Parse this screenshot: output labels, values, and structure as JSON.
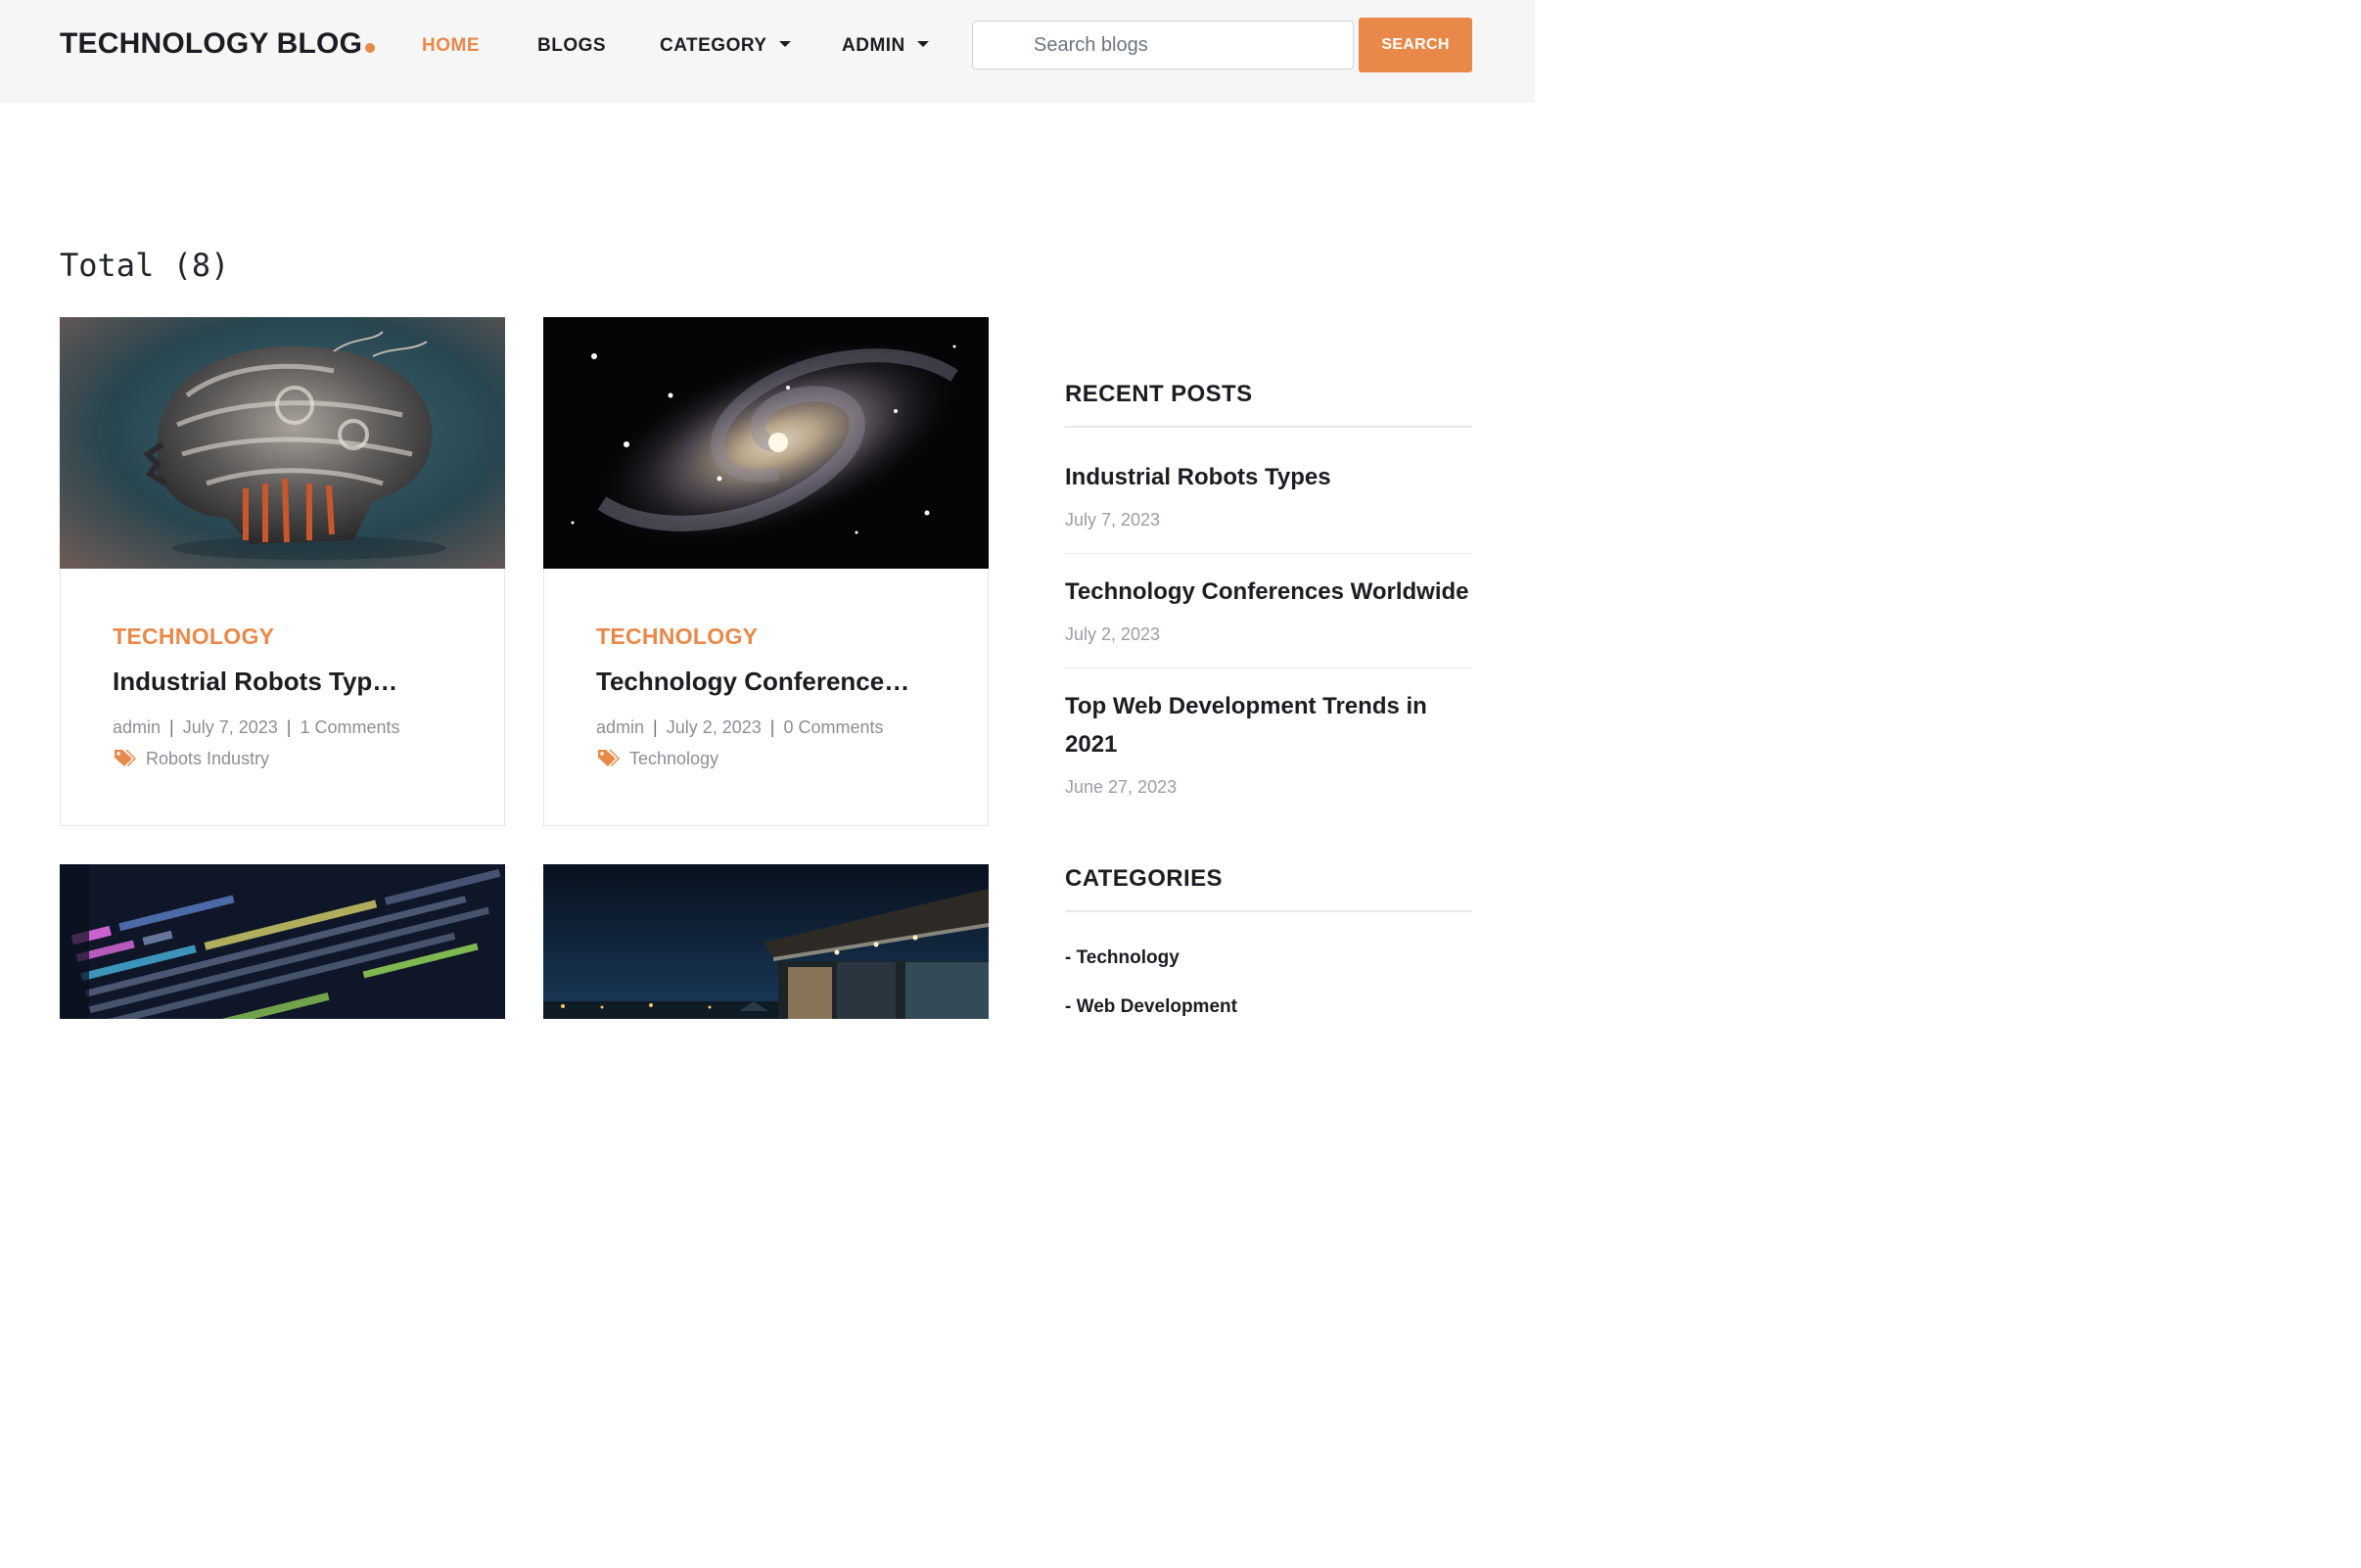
{
  "header": {
    "brand": "TECHNOLOGY BLOG",
    "nav": [
      "HOME",
      "BLOGS",
      "CATEGORY",
      "ADMIN"
    ],
    "search_placeholder": "Search blogs",
    "search_button": "SEARCH"
  },
  "main": {
    "total_label": "Total (8)",
    "posts": [
      {
        "category": "TECHNOLOGY",
        "title": "Industrial Robots Typ…",
        "author": "admin",
        "date": "July 7, 2023",
        "comments": "1 Comments",
        "tags": "Robots Industry",
        "image": "mechanical-brain-image"
      },
      {
        "category": "TECHNOLOGY",
        "title": "Technology Conference…",
        "author": "admin",
        "date": "July 2, 2023",
        "comments": "0 Comments",
        "tags": "Technology",
        "image": "spiral-galaxy-image"
      },
      {
        "image": "code-screen-image"
      },
      {
        "image": "night-building-image"
      }
    ]
  },
  "sidebar": {
    "recent_heading": "RECENT POSTS",
    "recent": [
      {
        "title": "Industrial Robots Types",
        "date": "July 7, 2023"
      },
      {
        "title": "Technology Conferences Worldwide",
        "date": "July 2, 2023"
      },
      {
        "title": "Top Web Development Trends in 2021",
        "date": "June 27, 2023"
      }
    ],
    "categories_heading": "CATEGORIES",
    "categories": [
      "- Technology",
      "- Web Development"
    ]
  },
  "colors": {
    "accent": "#e8894a",
    "text": "#1b1d21",
    "muted": "#8a8f94",
    "nav_bg": "#f6f6f6"
  }
}
